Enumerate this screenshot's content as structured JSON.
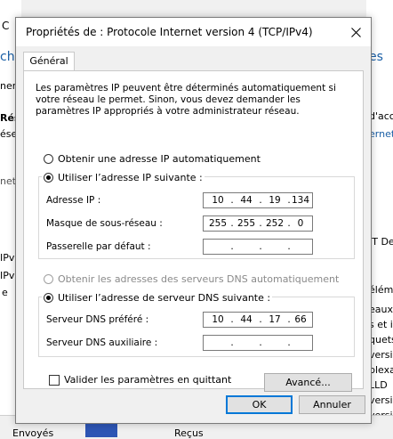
{
  "background": {
    "left_fragments": [
      "C",
      "che",
      "ner",
      "Rése",
      "ése",
      "net",
      "IPv",
      "IPv",
      "e"
    ],
    "right_fragments": [
      "es",
      "d'acc",
      "ernet",
      "IT De",
      "élém",
      "eaux",
      "s et im",
      "quets",
      "versio",
      "plexag",
      "LLD",
      "versio",
      "versio"
    ],
    "bottom_left": "Envoyés",
    "bottom_right": "Reçus"
  },
  "dialog": {
    "title": "Propriétés de : Protocole Internet version 4 (TCP/IPv4)",
    "tab": "Général",
    "description": "Les paramètres IP peuvent être déterminés automatiquement si votre réseau le permet. Sinon, vous devez demander les paramètres IP appropriés à votre administrateur réseau.",
    "ip_auto": {
      "label": "Obtenir une adresse IP automatiquement",
      "checked": false
    },
    "ip_manual": {
      "label": "Utiliser l’adresse IP suivante :",
      "checked": true
    },
    "ip_address": {
      "label": "Adresse IP :",
      "octets": [
        "10",
        "44",
        "19",
        "134"
      ]
    },
    "subnet_mask": {
      "label": "Masque de sous-réseau :",
      "octets": [
        "255",
        "255",
        "252",
        "0"
      ]
    },
    "gateway": {
      "label": "Passerelle par défaut :",
      "octets": [
        "",
        "",
        "",
        ""
      ]
    },
    "dns_auto": {
      "label": "Obtenir les adresses des serveurs DNS automatiquement",
      "checked": false,
      "disabled": true
    },
    "dns_manual": {
      "label": "Utiliser l’adresse de serveur DNS suivante :",
      "checked": true
    },
    "dns_preferred": {
      "label": "Serveur DNS préféré :",
      "octets": [
        "10",
        "44",
        "17",
        "66"
      ]
    },
    "dns_alternate": {
      "label": "Serveur DNS auxiliaire :",
      "octets": [
        "",
        "",
        "",
        ""
      ]
    },
    "validate": {
      "label": "Valider les paramètres en quittant",
      "checked": false
    },
    "advanced_button": "Avancé...",
    "ok_button": "OK",
    "cancel_button": "Annuler"
  },
  "colors": {
    "accent": "#0078d7",
    "window_bg": "#f0f0f0",
    "panel_bg": "#ffffff"
  }
}
